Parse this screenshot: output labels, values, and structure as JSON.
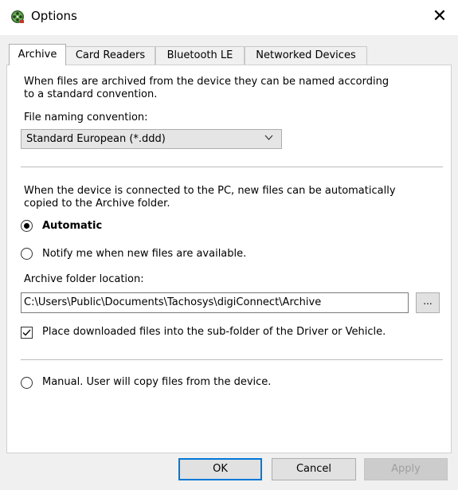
{
  "window": {
    "title": "Options",
    "close_glyph": "✕",
    "app_icon": "film-reel-icon"
  },
  "tabs": [
    {
      "label": "Archive",
      "active": true
    },
    {
      "label": "Card Readers",
      "active": false
    },
    {
      "label": "Bluetooth LE",
      "active": false
    },
    {
      "label": "Networked Devices",
      "active": false
    }
  ],
  "archive": {
    "intro_line1": "When files are archived from the device they can be named according",
    "intro_line2": "to a standard convention.",
    "naming_label": "File naming convention:",
    "naming_value": "Standard European (*.ddd)",
    "connect_line1": "When the device is connected to the PC, new files can be automatically",
    "connect_line2": "copied to the Archive folder.",
    "radio_automatic": "Automatic",
    "radio_notify": "Notify me when new files are available.",
    "folder_label": "Archive folder location:",
    "folder_path": "C:\\Users\\Public\\Documents\\Tachosys\\digiConnect\\Archive",
    "browse_label": "...",
    "subfolder_label": "Place downloaded files into the sub-folder of the Driver or Vehicle.",
    "subfolder_checked": true,
    "radio_manual": "Manual.  User will copy files from the device.",
    "selected_mode": "automatic"
  },
  "buttons": {
    "ok": "OK",
    "cancel": "Cancel",
    "apply": "Apply"
  }
}
